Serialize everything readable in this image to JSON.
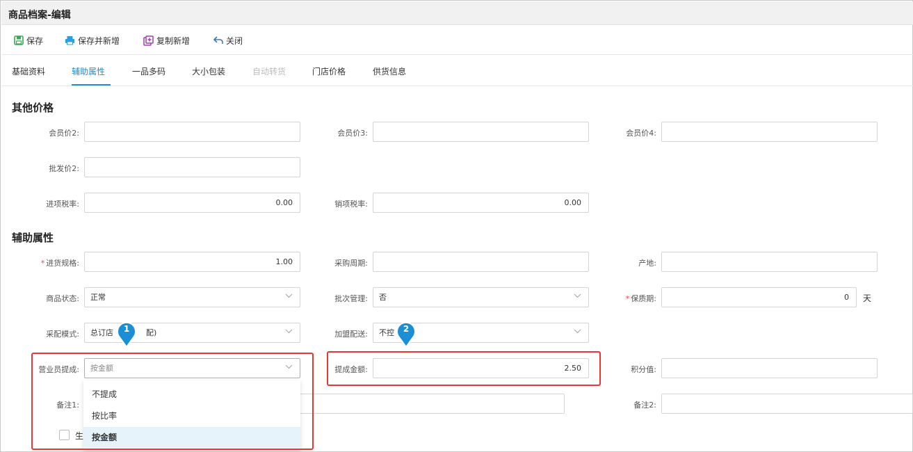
{
  "window": {
    "title": "商品档案-编辑"
  },
  "toolbar": {
    "save_label": "保存",
    "save_new_label": "保存并新增",
    "copy_new_label": "复制新增",
    "close_label": "关闭"
  },
  "tabs": [
    {
      "label": "基础资料"
    },
    {
      "label": "辅助属性",
      "active": true
    },
    {
      "label": "一品多码"
    },
    {
      "label": "大小包装"
    },
    {
      "label": "自动转货",
      "disabled": true
    },
    {
      "label": "门店价格"
    },
    {
      "label": "供货信息"
    }
  ],
  "other_prices": {
    "heading": "其他价格",
    "member_price2": {
      "label": "会员价2:",
      "value": ""
    },
    "member_price3": {
      "label": "会员价3:",
      "value": ""
    },
    "member_price4": {
      "label": "会员价4:",
      "value": ""
    },
    "wholesale_price2": {
      "label": "批发价2:",
      "value": ""
    },
    "input_tax": {
      "label": "进项税率:",
      "value": "0.00"
    },
    "output_tax": {
      "label": "销项税率:",
      "value": "0.00"
    }
  },
  "aux_attrs": {
    "heading": "辅助属性",
    "purchase_spec": {
      "label": "进货规格:",
      "required_mark": "*",
      "value": "1.00"
    },
    "purchase_cycle": {
      "label": "采购周期:",
      "value": ""
    },
    "origin": {
      "label": "产地:",
      "value": ""
    },
    "status": {
      "label": "商品状态:",
      "value": "正常"
    },
    "batch_mgmt": {
      "label": "批次管理:",
      "value": "否"
    },
    "shelf_life": {
      "label": "保质期:",
      "required_mark": "*",
      "value": "0",
      "unit": "天"
    },
    "purchase_mode": {
      "label": "采配模式:",
      "value": "总订店",
      "value_tail": "配)"
    },
    "franchise_delivery": {
      "label": "加盟配送:",
      "value": "不控"
    },
    "commission": {
      "label": "营业员提成:",
      "value": "按金额"
    },
    "commission_amount": {
      "label": "提成金额:",
      "value": "2.50"
    },
    "points": {
      "label": "积分值:",
      "value": ""
    },
    "remark1": {
      "label": "备注1:",
      "value": ""
    },
    "remark2": {
      "label": "备注2:",
      "value": ""
    },
    "checkbox_label": "生"
  },
  "dropdown": {
    "options": [
      {
        "label": "不提成"
      },
      {
        "label": "按比率"
      },
      {
        "label": "按金额",
        "selected": true
      }
    ]
  },
  "markers": [
    {
      "number": "1"
    },
    {
      "number": "2"
    }
  ],
  "colors": {
    "accent": "#1a8fd6",
    "highlight": "#e33333",
    "marker": "#1a8fd6"
  }
}
